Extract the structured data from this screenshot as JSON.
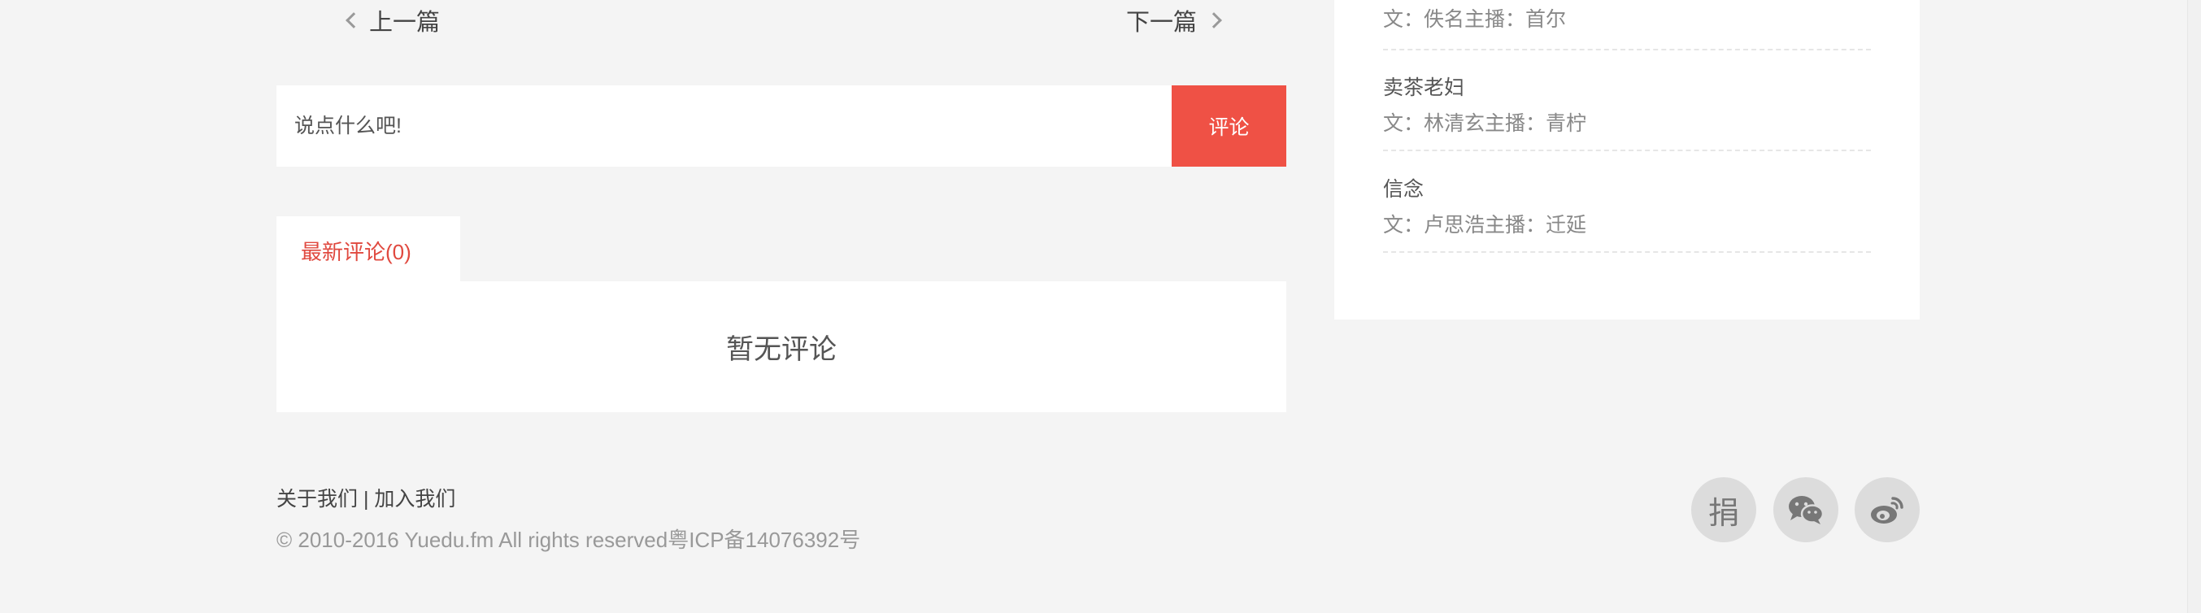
{
  "post_nav": {
    "prev_label": "上一篇",
    "next_label": "下一篇"
  },
  "comment_form": {
    "placeholder": "说点什么吧!",
    "submit_label": "评论"
  },
  "comments": {
    "tab_label": "最新评论(0)",
    "empty_text": "暂无评论"
  },
  "sidebar": {
    "items": [
      {
        "title": "",
        "meta": "文：佚名主播：首尔"
      },
      {
        "title": "卖茶老妇",
        "meta": "文：林清玄主播：青柠"
      },
      {
        "title": "信念",
        "meta": "文：卢思浩主播：迁延"
      }
    ]
  },
  "footer": {
    "about_label": "关于我们",
    "separator": "|",
    "join_label": "加入我们",
    "copyright": "© 2010-2016 Yuedu.fm All rights reserved粤ICP备14076392号"
  },
  "social": {
    "donate_label": "捐",
    "icons": [
      "wechat-icon",
      "weibo-icon"
    ]
  },
  "colors": {
    "accent": "#ef5145",
    "tab_active": "#e0493f",
    "background": "#f4f4f4"
  }
}
